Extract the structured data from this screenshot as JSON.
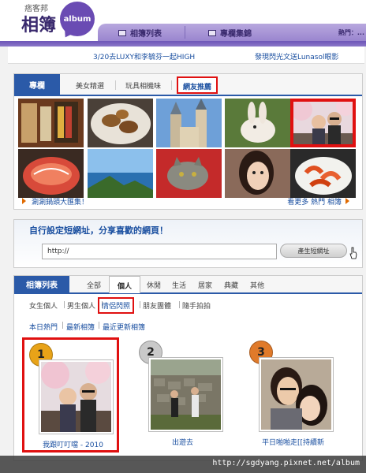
{
  "header": {
    "logo_small": "痞客邦",
    "logo_big": "相簿",
    "album_badge": "album",
    "tabs": [
      {
        "label": "相簿列表",
        "icon": "photo-list-icon"
      },
      {
        "label": "專欄集錦",
        "icon": "column-icon"
      }
    ],
    "popular_label": "熱門：..."
  },
  "promo_links": [
    "3/20去LUXY和李毓芬一起HIGH",
    "發現閃光文送Lunasol眼影"
  ],
  "featured": {
    "heading": "專欄",
    "tabs": [
      "美女精選",
      "玩具相機味",
      "網友推薦"
    ],
    "active_tab": "網友推薦",
    "thumbnails": [
      "bookshop",
      "grilled-fish",
      "church-towers",
      "rabbit",
      "couple-cherry-blossom",
      "sashimi",
      "seaside-cliff",
      "cat-on-red",
      "girl-portrait",
      "shrimp-dish"
    ],
    "highlighted_thumbnail": "couple-cherry-blossom",
    "footer_left": "涮涮鍋頭大匯集！",
    "footer_right": "看更多 熱門 相簿"
  },
  "short_url": {
    "title": "自行設定短網址，分享喜歡的網頁！",
    "input_value": "http://",
    "button_label": "產生短網址"
  },
  "albums": {
    "heading": "相簿列表",
    "tabs": [
      "全部",
      "個人",
      "休閒",
      "生活",
      "居家",
      "典藏",
      "其他"
    ],
    "active_tab": "個人",
    "subtabs": [
      "女生個人",
      "男生個人",
      "情侶閃照",
      "朋友團體",
      "隨手拍拍"
    ],
    "active_subtab": "情侶閃照",
    "sort": [
      "本日熱門",
      "最新相簿",
      "最近更新相簿"
    ],
    "cards": [
      {
        "rank": "1",
        "caption": "我跟叮叮噹 - 2010",
        "rank_color": "#e8a318"
      },
      {
        "rank": "2",
        "caption": "出遊去",
        "rank_color": "#c9c9c9"
      },
      {
        "rank": "3",
        "caption": "平日啪啪走[[持續新",
        "rank_color": "#e07a2a"
      }
    ]
  },
  "watermark": "http://sgdyang.pixnet.net/album",
  "colors": {
    "accent_blue": "#2b5aa8",
    "highlight_red": "#e01010",
    "brand_purple": "#6a4bb3"
  }
}
